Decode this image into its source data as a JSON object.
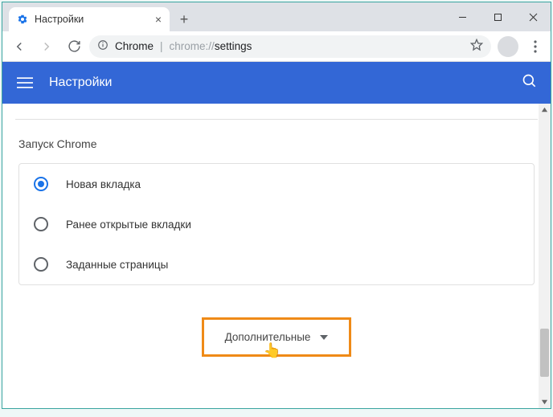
{
  "window": {
    "tab_title": "Настройки"
  },
  "address": {
    "label": "Chrome",
    "url_dim": "chrome://",
    "url_strong": "settings"
  },
  "header": {
    "title": "Настройки"
  },
  "section": {
    "title": "Запуск Chrome"
  },
  "options": {
    "new_tab": "Новая вкладка",
    "continue": "Ранее открытые вкладки",
    "specific": "Заданные страницы"
  },
  "advanced": {
    "label": "Дополнительные"
  }
}
